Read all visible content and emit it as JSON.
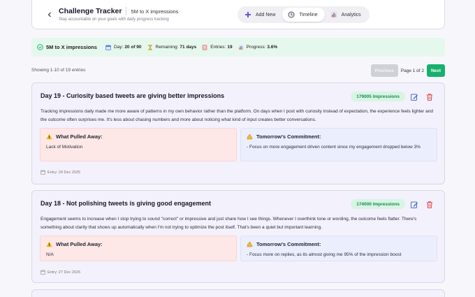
{
  "header": {
    "title": "Challenge Tracker",
    "challenge": "5M to X impressions",
    "subtitle": "Stay accountable on your goals with daily progress tracking"
  },
  "nav": [
    {
      "label": "Add New",
      "icon": "plus-icon"
    },
    {
      "label": "Timeline",
      "icon": "clock-icon",
      "active": true
    },
    {
      "label": "Analytics",
      "icon": "bar-chart-icon"
    }
  ],
  "stats": {
    "goal": "5M to X impressions",
    "day_label": "Day:",
    "day_value": "20 of 90",
    "remaining_label": "Remaining:",
    "remaining_value": "71 days",
    "entries_label": "Entries:",
    "entries_value": "19",
    "progress_label": "Progress:",
    "progress_value": "3.6%"
  },
  "pagination": {
    "showing": "Showing 1-10 of 19 entries",
    "prev": "Previous",
    "page": "Page 1 of 2",
    "next": "Next"
  },
  "entries": [
    {
      "title": "Day 19 - Curiosity based tweets are giving better impressions",
      "impressions": "179005 Impressions",
      "body": "Tracking impressions daily made me more aware of patterns in my own behavior rather than the platform. On days when I post with curiosity instead of expectation, the experience feels lighter and the outcome often surprises me. It's less about chasing numbers and more about noticing what kind of input creates better conversations.",
      "pulled_label": "What Pulled Away:",
      "pulled_text": "Lack of Motivation",
      "commit_label": "Tomorrow's Commitment:",
      "commit_text": "- Focus on more engagement driven content since my engagement dropped below 3%",
      "date": "Entry: 29 Dec 2025"
    },
    {
      "title": "Day 18 - Not polishing tweets is giving good engagement",
      "impressions": "174000 Impressions",
      "body": "Engagement seems to increase when I stop trying to sound \"correct\" or impressive and just share how I see things. Whenever I overthink tone or wording, the outcome feels flatter. There's something about clarity that shows up automatically when I'm not trying to optimize the post itself. That's been a quiet but important learning.",
      "pulled_label": "What Pulled Away:",
      "pulled_text": "N/A",
      "commit_label": "Tomorrow's Commitment:",
      "commit_text": "- Focus more on replies, as its almost giving me 95% of the impression boost",
      "date": "Entry: 27 Dec 2025"
    }
  ],
  "colors": {
    "accent_green": "#17b06e",
    "stats_bg": "#e6f8ee",
    "card_bg": "#f3f1fb",
    "pull_bg": "#fde7e7",
    "commit_bg": "#ebeefc"
  }
}
